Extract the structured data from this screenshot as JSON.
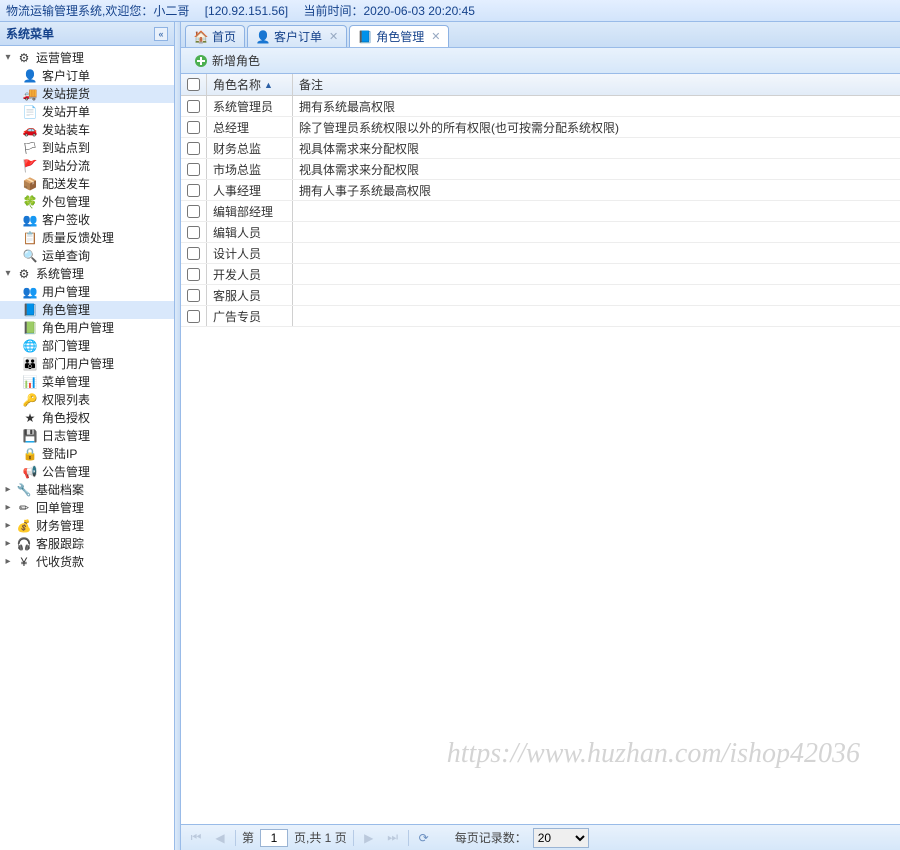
{
  "header": {
    "system_name": "物流运输管理系统",
    "welcome_prefix": ",欢迎您：",
    "user": "小二哥",
    "ip": "[120.92.151.56]",
    "time_label": "当前时间：",
    "time_value": "2020-06-03 20:20:45"
  },
  "sidebar": {
    "title": "系统菜单",
    "sections": [
      {
        "label": "运营管理",
        "icon": "gear-icon",
        "expanded": true,
        "children": [
          {
            "label": "客户订单",
            "icon": "user-icon"
          },
          {
            "label": "发站提货",
            "icon": "truck-icon",
            "selected": true
          },
          {
            "label": "发站开单",
            "icon": "doc-icon"
          },
          {
            "label": "发站装车",
            "icon": "car-icon"
          },
          {
            "label": "到站点到",
            "icon": "flag-blue-icon"
          },
          {
            "label": "到站分流",
            "icon": "flag-orange-icon"
          },
          {
            "label": "配送发车",
            "icon": "send-icon"
          },
          {
            "label": "外包管理",
            "icon": "leaf-icon"
          },
          {
            "label": "客户签收",
            "icon": "user-check-icon"
          },
          {
            "label": "质量反馈处理",
            "icon": "form-icon"
          },
          {
            "label": "运单查询",
            "icon": "search-icon"
          }
        ]
      },
      {
        "label": "系统管理",
        "icon": "gear-icon",
        "expanded": true,
        "children": [
          {
            "label": "用户管理",
            "icon": "users-icon"
          },
          {
            "label": "角色管理",
            "icon": "role-icon",
            "selected": true
          },
          {
            "label": "角色用户管理",
            "icon": "role-user-icon"
          },
          {
            "label": "部门管理",
            "icon": "globe-icon"
          },
          {
            "label": "部门用户管理",
            "icon": "users-dept-icon"
          },
          {
            "label": "菜单管理",
            "icon": "menu-icon"
          },
          {
            "label": "权限列表",
            "icon": "key-icon"
          },
          {
            "label": "角色授权",
            "icon": "grant-icon"
          },
          {
            "label": "日志管理",
            "icon": "log-icon"
          },
          {
            "label": "登陆IP",
            "icon": "lock-icon"
          },
          {
            "label": "公告管理",
            "icon": "announce-icon"
          }
        ]
      },
      {
        "label": "基础档案",
        "icon": "wrench-icon",
        "expanded": false,
        "children": []
      },
      {
        "label": "回单管理",
        "icon": "pencil-icon",
        "expanded": false,
        "children": []
      },
      {
        "label": "财务管理",
        "icon": "money-icon",
        "expanded": false,
        "children": []
      },
      {
        "label": "客服跟踪",
        "icon": "headset-icon",
        "expanded": false,
        "children": []
      },
      {
        "label": "代收货款",
        "icon": "yen-icon",
        "expanded": false,
        "children": []
      }
    ]
  },
  "tabs": [
    {
      "label": "首页",
      "icon": "home-icon",
      "closable": false,
      "active": false
    },
    {
      "label": "客户订单",
      "icon": "user-icon",
      "closable": true,
      "active": false
    },
    {
      "label": "角色管理",
      "icon": "role-icon",
      "closable": true,
      "active": true
    }
  ],
  "toolbar": {
    "add_label": "新增角色"
  },
  "grid": {
    "columns": {
      "name": "角色名称",
      "remark": "备注"
    },
    "rows": [
      {
        "name": "系统管理员",
        "remark": "拥有系统最高权限"
      },
      {
        "name": "总经理",
        "remark": "除了管理员系统权限以外的所有权限(也可按需分配系统权限)"
      },
      {
        "name": "财务总监",
        "remark": "视具体需求来分配权限"
      },
      {
        "name": "市场总监",
        "remark": "视具体需求来分配权限"
      },
      {
        "name": "人事经理",
        "remark": "拥有人事子系统最高权限"
      },
      {
        "name": "编辑部经理",
        "remark": ""
      },
      {
        "name": "编辑人员",
        "remark": ""
      },
      {
        "name": "设计人员",
        "remark": ""
      },
      {
        "name": "开发人员",
        "remark": ""
      },
      {
        "name": "客服人员",
        "remark": ""
      },
      {
        "name": "广告专员",
        "remark": ""
      }
    ]
  },
  "paging": {
    "label_page_prefix": "第",
    "page": "1",
    "label_page_suffix": "页,共 1 页",
    "page_size_label": "每页记录数：",
    "page_size": "20"
  },
  "icon_map": {
    "gear-icon": "⚙",
    "user-icon": "👤",
    "truck-icon": "🚚",
    "doc-icon": "📄",
    "car-icon": "🚗",
    "flag-blue-icon": "🏳",
    "flag-orange-icon": "🚩",
    "send-icon": "📦",
    "leaf-icon": "🍀",
    "user-check-icon": "👥",
    "form-icon": "📋",
    "search-icon": "🔍",
    "users-icon": "👥",
    "role-icon": "📘",
    "role-user-icon": "📗",
    "globe-icon": "🌐",
    "users-dept-icon": "👪",
    "menu-icon": "📊",
    "key-icon": "🔑",
    "grant-icon": "★",
    "log-icon": "💾",
    "lock-icon": "🔒",
    "announce-icon": "📢",
    "wrench-icon": "🔧",
    "pencil-icon": "✏",
    "money-icon": "💰",
    "headset-icon": "🎧",
    "yen-icon": "¥",
    "home-icon": "🏠",
    "plus-icon": "➕"
  },
  "watermark": "https://www.huzhan.com/ishop42036"
}
